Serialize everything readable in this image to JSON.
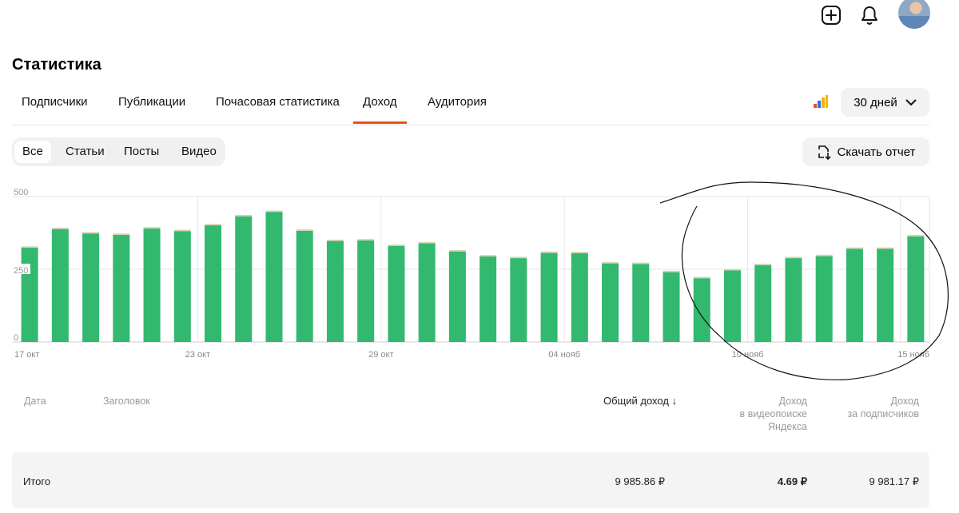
{
  "page": {
    "title": "Статистика"
  },
  "tabs": [
    "Подписчики",
    "Публикации",
    "Почасовая статистика",
    "Доход",
    "Аудитория"
  ],
  "active_tab": "Доход",
  "period": {
    "label": "30 дней"
  },
  "filters": [
    "Все",
    "Статьи",
    "Посты",
    "Видео"
  ],
  "active_filter": "Все",
  "download": {
    "label": "Скачать отчет"
  },
  "icons": [
    "plus-icon",
    "bell-icon",
    "avatar",
    "chart-type-icon",
    "chevron-down-icon",
    "download-report-icon",
    "sort-down-arrow-icon"
  ],
  "colors": {
    "accent": "#ef4f1a",
    "bar": "#32b96f",
    "bar_cap": "#d9d2b0",
    "grid": "#e6e6e6"
  },
  "chart_data": {
    "type": "bar",
    "stacked": true,
    "categories": [
      "17 окт",
      "18 окт",
      "19 окт",
      "20 окт",
      "21 окт",
      "22 окт",
      "23 окт",
      "24 окт",
      "25 окт",
      "26 окт",
      "27 окт",
      "28 окт",
      "29 окт",
      "30 окт",
      "31 окт",
      "01 нояб",
      "02 нояб",
      "03 нояб",
      "04 нояб",
      "05 нояб",
      "06 нояб",
      "07 нояб",
      "08 нояб",
      "09 нояб",
      "10 нояб",
      "11 нояб",
      "12 нояб",
      "13 нояб",
      "14 нояб",
      "15 нояб"
    ],
    "x_tick_labels": [
      "17 окт",
      "23 окт",
      "29 окт",
      "04 нояб",
      "10 нояб",
      "15 нояб"
    ],
    "y_ticks": [
      0,
      250,
      500
    ],
    "ylim": [
      0,
      500
    ],
    "series": [
      {
        "values": [
          324,
          388,
          373,
          368,
          390,
          381,
          401,
          432,
          447,
          382,
          347,
          349,
          330,
          339,
          311,
          294,
          288,
          306,
          305,
          270,
          268,
          240,
          219,
          246,
          264,
          288,
          295,
          320,
          320,
          363
        ]
      },
      {
        "values": [
          5,
          5,
          5,
          5,
          5,
          5,
          5,
          5,
          5,
          5,
          5,
          5,
          5,
          5,
          5,
          5,
          5,
          5,
          5,
          5,
          5,
          5,
          5,
          5,
          5,
          5,
          5,
          5,
          5,
          5
        ]
      }
    ],
    "grid": true
  },
  "table": {
    "headers": {
      "date": "Дата",
      "title": "Заголовок",
      "total": "Общий доход",
      "video_search_1": "Доход",
      "video_search_2": "в видеопоиске Яндекса",
      "subscribers_1": "Доход",
      "subscribers_2": "за подписчиков"
    },
    "total_row": {
      "label": "Итого",
      "total": "9 985.86 ₽",
      "video_search": "4.69 ₽",
      "subscribers": "9 981.17 ₽"
    }
  }
}
